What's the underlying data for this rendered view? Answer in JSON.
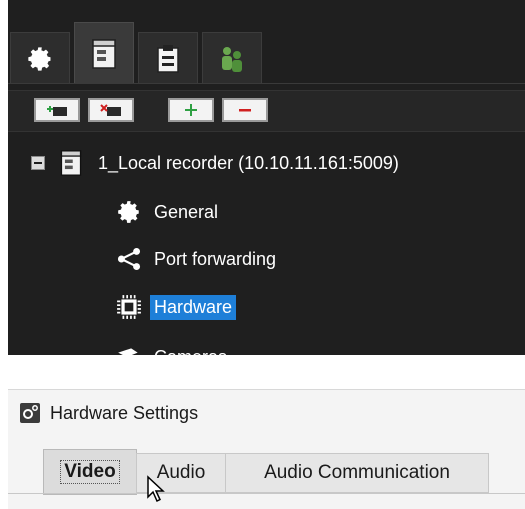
{
  "top_tabs": [
    {
      "icon": "gear-icon",
      "active": false
    },
    {
      "icon": "server-icon",
      "active": true
    },
    {
      "icon": "clipboard-icon",
      "active": false
    },
    {
      "icon": "users-icon",
      "active": false
    }
  ],
  "toolbar": {
    "buttons": [
      {
        "icon": "add-recorder-icon"
      },
      {
        "icon": "remove-recorder-icon"
      },
      {
        "icon": "plus-icon"
      },
      {
        "icon": "minus-icon"
      }
    ]
  },
  "tree": {
    "root_label": "1_Local recorder (10.10.11.161:5009)",
    "items": [
      {
        "label": "General",
        "icon": "gear-icon"
      },
      {
        "label": "Port forwarding",
        "icon": "share-icon"
      },
      {
        "label": "Hardware",
        "icon": "chip-icon",
        "selected": true
      },
      {
        "label": "Cameras",
        "icon": "camera-icon"
      }
    ]
  },
  "settings": {
    "title": "Hardware Settings",
    "tabs": [
      "Video",
      "Audio",
      "Audio Communication"
    ],
    "active_tab": "Video"
  },
  "colors": {
    "dark_bg": "#1f1f1f",
    "selection": "#1e7fd8",
    "light_bg": "#f4f4f4"
  }
}
